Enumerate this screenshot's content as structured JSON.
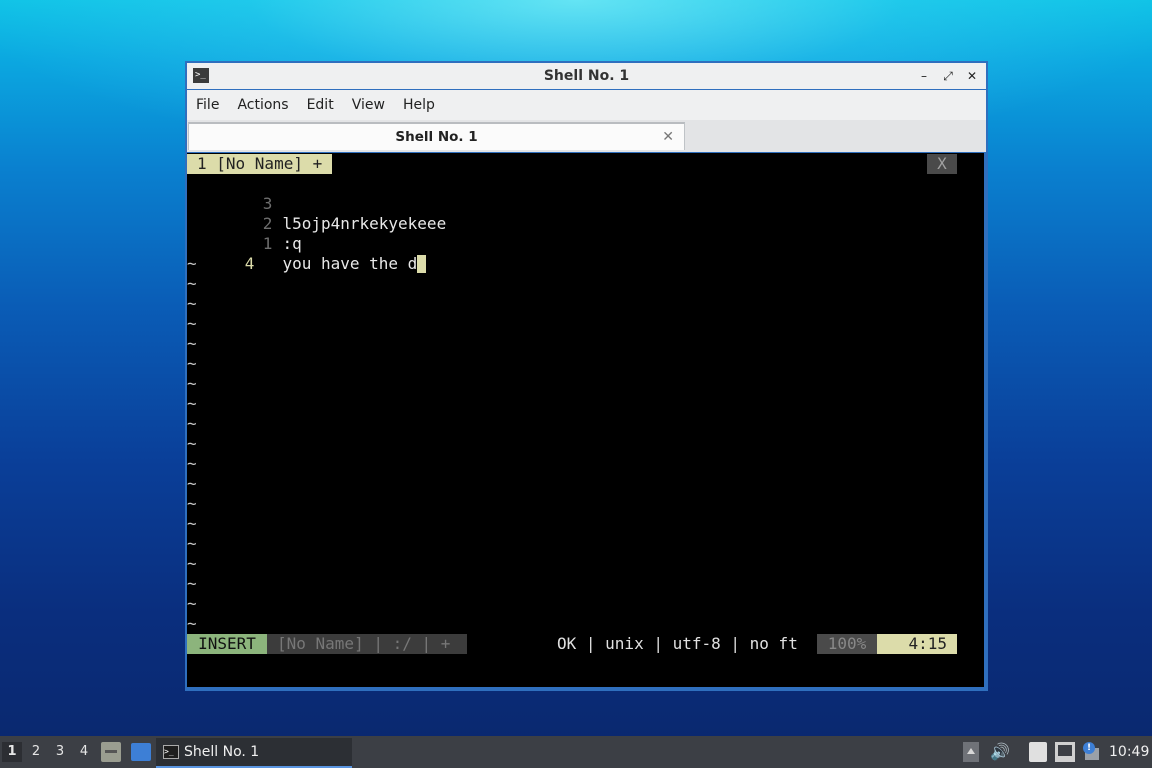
{
  "window": {
    "title": "Shell No. 1",
    "icon_symbol": ">_",
    "controls": {
      "minimize": "–",
      "maximize": "⤢",
      "close": "✕"
    }
  },
  "menubar": {
    "items": [
      "File",
      "Actions",
      "Edit",
      "View",
      "Help"
    ]
  },
  "tabs": [
    {
      "label": "Shell No. 1",
      "close": "✕"
    }
  ],
  "editor": {
    "buffer_tab": "1 [No Name] +",
    "buffer_close": "X",
    "lines": [
      {
        "num": "3",
        "text": ""
      },
      {
        "num": "2",
        "text": "l5ojp4nrkekyekeee"
      },
      {
        "num": "1",
        "text": ":q"
      },
      {
        "num": "4",
        "text": "you have the d"
      }
    ],
    "tilde": "~",
    "tilde_count": 19,
    "status": {
      "mode": "INSERT",
      "file": "[No Name] | :/ | +",
      "info": "OK | unix | utf-8 | no ft",
      "percent": "100%",
      "position": "4:15"
    }
  },
  "taskbar": {
    "workspaces": [
      "1",
      "2",
      "3",
      "4"
    ],
    "active_workspace": "1",
    "task_label": "Shell No. 1",
    "notification_badge": "!",
    "clock": "10:49"
  },
  "colors": {
    "status_mode_bg": "#8cb47c",
    "buffer_active_bg": "#dcdcaa",
    "window_border": "#2f6fbe",
    "taskbar_bg": "#3c3f45"
  }
}
